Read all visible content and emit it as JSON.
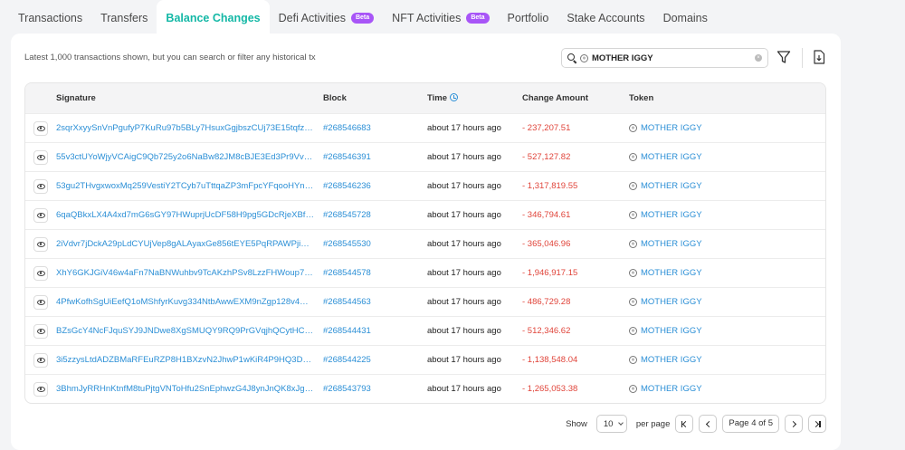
{
  "tabs": [
    {
      "label": "Transactions",
      "badge": ""
    },
    {
      "label": "Transfers",
      "badge": ""
    },
    {
      "label": "Balance Changes",
      "badge": ""
    },
    {
      "label": "Defi Activities",
      "badge": "Beta"
    },
    {
      "label": "NFT Activities",
      "badge": "Beta"
    },
    {
      "label": "Portfolio",
      "badge": ""
    },
    {
      "label": "Stake Accounts",
      "badge": ""
    },
    {
      "label": "Domains",
      "badge": ""
    }
  ],
  "active_tab": 2,
  "toolbar": {
    "notice": "Latest 1,000 transactions shown, but you can search or filter any historical tx",
    "search_value": "MOTHER IGGY",
    "clear_glyph": "×",
    "search_icon": "search-icon",
    "filter_icon": "filter-icon",
    "export_icon": "export-icon"
  },
  "table": {
    "headers": {
      "signature": "Signature",
      "block": "Block",
      "time": "Time",
      "amount": "Change Amount",
      "token": "Token"
    },
    "rows": [
      {
        "signature": "2sqrXxyySnVnPgufyP7KuRu97b5BLy7HsuxGgjbszCUj73E15tqfzuMX...",
        "block": "#268546683",
        "time": "about 17 hours ago",
        "amount": "- 237,207.51",
        "token": "MOTHER IGGY"
      },
      {
        "signature": "55v3ctUYoWjyVCAigC9Qb725y2o6NaBw82JM8cBJE3Ed3Pr9VvyH...",
        "block": "#268546391",
        "time": "about 17 hours ago",
        "amount": "- 527,127.82",
        "token": "MOTHER IGGY"
      },
      {
        "signature": "53gu2THvgxwoxMq259VestiY2TCyb7uTttqaZP3mFpcYFqooHYnHH...",
        "block": "#268546236",
        "time": "about 17 hours ago",
        "amount": "- 1,317,819.55",
        "token": "MOTHER IGGY"
      },
      {
        "signature": "6qaQBkxLX4A4xd7mG6sGY97HWuprjUcDF58H9pg5GDcRjeXBfxb7F...",
        "block": "#268545728",
        "time": "about 17 hours ago",
        "amount": "- 346,794.61",
        "token": "MOTHER IGGY"
      },
      {
        "signature": "2iVdvr7jDckA29pLdCYUjVep8gALAyaxGe856tEYE5PqRPAWPjiBJDL...",
        "block": "#268545530",
        "time": "about 17 hours ago",
        "amount": "- 365,046.96",
        "token": "MOTHER IGGY"
      },
      {
        "signature": "XhY6GKJGiV46w4aFn7NaBNWuhbv9TcAKzhPSv8LzzFHWoup7pUir...",
        "block": "#268544578",
        "time": "about 17 hours ago",
        "amount": "- 1,946,917.15",
        "token": "MOTHER IGGY"
      },
      {
        "signature": "4PfwKofhSgUiEefQ1oMShfyrKuvg334NtbAwwEXM9nZgp128v4Qr5b...",
        "block": "#268544563",
        "time": "about 17 hours ago",
        "amount": "- 486,729.28",
        "token": "MOTHER IGGY"
      },
      {
        "signature": "BZsGcY4NcFJquSYJ9JNDwe8XgSMUQY9RQ9PrGVqjhQCytHCsT21...",
        "block": "#268544431",
        "time": "about 17 hours ago",
        "amount": "- 512,346.62",
        "token": "MOTHER IGGY"
      },
      {
        "signature": "3i5zzysLtdADZBMaRFEuRZP8H1BXzvN2JhwP1wKiR4P9HQ3D1mM...",
        "block": "#268544225",
        "time": "about 17 hours ago",
        "amount": "- 1,138,548.04",
        "token": "MOTHER IGGY"
      },
      {
        "signature": "3BhmJyRRHnKtnfM8tuPjtgVNToHfu2SnEphwzG4J8ynJnQK8xJgfFD...",
        "block": "#268543793",
        "time": "about 17 hours ago",
        "amount": "- 1,265,053.38",
        "token": "MOTHER IGGY"
      }
    ]
  },
  "pagination": {
    "show_label": "Show",
    "per_page_value": "10",
    "per_page_label": "per page",
    "page_label": "Page 4 of 5"
  },
  "colors": {
    "accent": "#14b8a6",
    "link": "#2b8fd6",
    "negative": "#e0443a",
    "badge": "#a855f7"
  }
}
